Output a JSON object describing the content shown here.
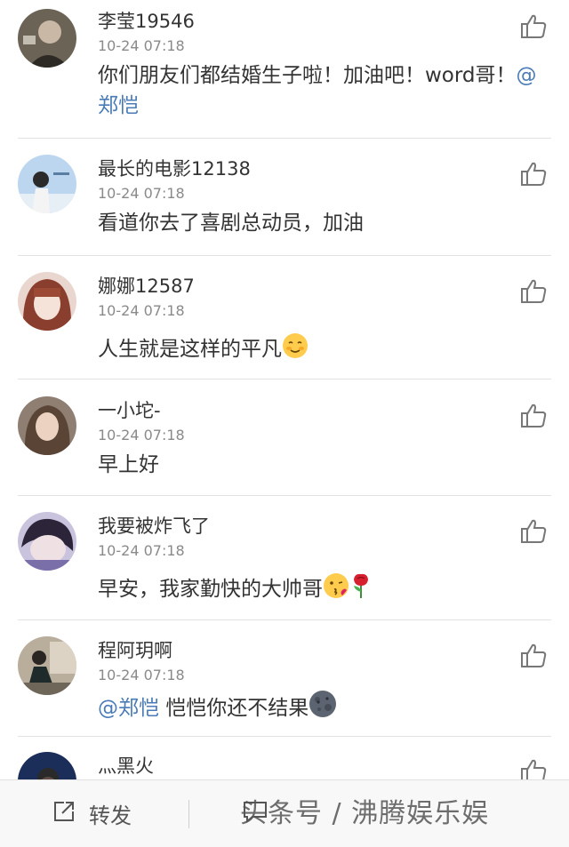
{
  "comments": [
    {
      "username": "李莹19546",
      "time": "10-24 07:18",
      "text_before": "你们朋友们都结婚生子啦！加油吧！word哥！",
      "mention": "@郑恺",
      "text_after": ""
    },
    {
      "username": "最长的电影12138",
      "time": "10-24 07:18",
      "text": "看道你去了喜剧总动员，加油"
    },
    {
      "username": "娜娜12587",
      "time": "10-24 07:18",
      "text": "人生就是这样的平凡",
      "emoji": "blush-emoji"
    },
    {
      "username": "一小坨-",
      "time": "10-24 07:18",
      "text": "早上好"
    },
    {
      "username": "我要被炸飞了",
      "time": "10-24 07:18",
      "text": "早安，我家勤快的大帅哥",
      "emoji": [
        "kiss-emoji",
        "rose-emoji"
      ]
    },
    {
      "username": "程阿玥啊",
      "time": "10-24 07:18",
      "mention": "@郑恺",
      "text": " 恺恺你还不结果",
      "emoji": "new-moon-face-emoji"
    },
    {
      "username": "灬黑火"
    }
  ],
  "bottom_bar": {
    "forward_label": "转发",
    "comment_label": "评论"
  },
  "watermark": "头条号 / 沸腾娱乐娱"
}
